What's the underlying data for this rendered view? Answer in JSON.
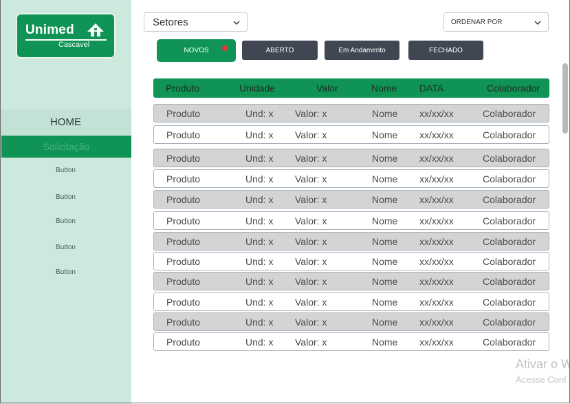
{
  "logo": {
    "name": "Unimed",
    "sub": "Cascavel"
  },
  "sidebar": {
    "home": "HOME",
    "active": "Solicitação",
    "buttons": [
      "Button",
      "Button",
      "Button",
      "Button",
      "Button"
    ]
  },
  "filters": {
    "sector": "Setores",
    "order": "ORDENAR POR"
  },
  "tabs": [
    "NOVOS",
    "ABERTO",
    "Em Andamento",
    "FECHADO"
  ],
  "table": {
    "headers": [
      "Produto",
      "Unidade",
      "Valor",
      "Nome",
      "DATA",
      "Colaborador"
    ],
    "rows": [
      [
        "Produto",
        "Und: x",
        "Valor:  x",
        "Nome",
        "xx/xx/xx",
        "Colaborador"
      ],
      [
        "Produto",
        "Und: x",
        "Valor:  x",
        "Nome",
        "xx/xx/xx",
        "Colaborador"
      ],
      [
        "Produto",
        "Und: x",
        "Valor:  x",
        "Nome",
        "xx/xx/xx",
        "Colaborador"
      ],
      [
        "Produto",
        "Und: x",
        "Valor:  x",
        "Nome",
        "xx/xx/xx",
        "Colaborador"
      ],
      [
        "Produto",
        "Und: x",
        "Valor:  x",
        "Nome",
        "xx/xx/xx",
        "Colaborador"
      ],
      [
        "Produto",
        "Und: x",
        "Valor:  x",
        "Nome",
        "xx/xx/xx",
        "Colaborador"
      ],
      [
        "Produto",
        "Und: x",
        "Valor:  x",
        "Nome",
        "xx/xx/xx",
        "Colaborador"
      ],
      [
        "Produto",
        "Und: x",
        "Valor:  x",
        "Nome",
        "xx/xx/xx",
        "Colaborador"
      ],
      [
        "Produto",
        "Und: x",
        "Valor:  x",
        "Nome",
        "xx/xx/xx",
        "Colaborador"
      ],
      [
        "Produto",
        "Und: x",
        "Valor:  x",
        "Nome",
        "xx/xx/xx",
        "Colaborador"
      ],
      [
        "Produto",
        "Und: x",
        "Valor:  x",
        "Nome",
        "xx/xx/xx",
        "Colaborador"
      ],
      [
        "Produto",
        "Und: x",
        "Valor:  x",
        "Nome",
        "xx/xx/xx",
        "Colaborador"
      ]
    ]
  },
  "watermark": {
    "line1": "Ativar o W",
    "line2": "Acesse Conf"
  },
  "colors": {
    "brand": "#0f9455",
    "sidebar": "#cde9dd",
    "tab": "#404753",
    "notify": "#e53935"
  }
}
